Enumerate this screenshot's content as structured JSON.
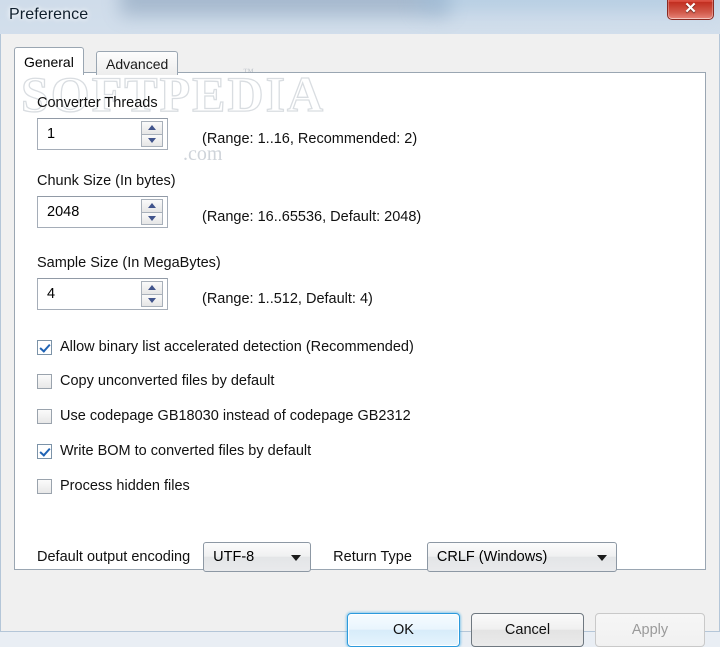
{
  "window": {
    "title": "Preference",
    "close_label": "✕"
  },
  "tabs": [
    {
      "label": "General",
      "active": true
    },
    {
      "label": "Advanced",
      "active": false
    }
  ],
  "watermark": {
    "text": "SOFTPEDIA",
    "tm": "™",
    "domain": ".com"
  },
  "fields": [
    {
      "label": "Converter Threads",
      "value": "1",
      "hint": "(Range: 1..16, Recommended: 2)"
    },
    {
      "label": "Chunk Size (In bytes)",
      "value": "2048",
      "hint": "(Range: 16..65536, Default: 2048)"
    },
    {
      "label": "Sample Size (In MegaBytes)",
      "value": "4",
      "hint": "(Range: 1..512, Default: 4)"
    }
  ],
  "checkboxes": [
    {
      "label": "Allow binary list accelerated detection (Recommended)",
      "checked": true
    },
    {
      "label": "Copy unconverted files by default",
      "checked": false
    },
    {
      "label": "Use codepage GB18030 instead of codepage GB2312",
      "checked": false
    },
    {
      "label": "Write BOM to converted files by default",
      "checked": true
    },
    {
      "label": "Process hidden files",
      "checked": false
    }
  ],
  "selects": {
    "encoding_label": "Default output encoding",
    "encoding_value": "UTF-8",
    "return_label": "Return Type",
    "return_value": "CRLF (Windows)"
  },
  "footer": {
    "ok": "OK",
    "cancel": "Cancel",
    "apply": "Apply"
  },
  "colors": {
    "accent": "#2c9adc",
    "check": "#1f63b5",
    "close": "#c22e20"
  }
}
